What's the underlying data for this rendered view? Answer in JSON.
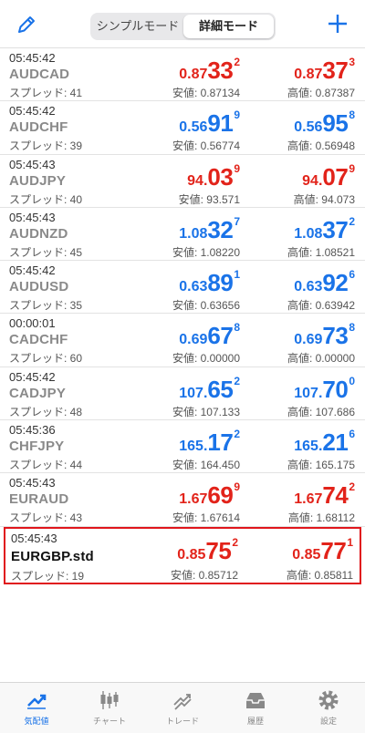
{
  "header": {
    "segment_simple": "シンプルモード",
    "segment_detail": "詳細モード"
  },
  "quotes": [
    {
      "time": "05:45:42",
      "symbol": "AUDCAD",
      "spread": "スプレッド: 41",
      "color": "red",
      "bid": {
        "small": "0.87",
        "big": "33",
        "sup": "2",
        "sub": "安値: 0.87134"
      },
      "ask": {
        "small": "0.87",
        "big": "37",
        "sup": "3",
        "sub": "高値: 0.87387"
      }
    },
    {
      "time": "05:45:42",
      "symbol": "AUDCHF",
      "spread": "スプレッド: 39",
      "color": "blue",
      "bid": {
        "small": "0.56",
        "big": "91",
        "sup": "9",
        "sub": "安値: 0.56774"
      },
      "ask": {
        "small": "0.56",
        "big": "95",
        "sup": "8",
        "sub": "高値: 0.56948"
      }
    },
    {
      "time": "05:45:43",
      "symbol": "AUDJPY",
      "spread": "スプレッド: 40",
      "color": "red",
      "bid": {
        "small": "94.",
        "big": "03",
        "sup": "9",
        "sub": "安値: 93.571"
      },
      "ask": {
        "small": "94.",
        "big": "07",
        "sup": "9",
        "sub": "高値: 94.073"
      }
    },
    {
      "time": "05:45:43",
      "symbol": "AUDNZD",
      "spread": "スプレッド: 45",
      "color": "blue",
      "bid": {
        "small": "1.08",
        "big": "32",
        "sup": "7",
        "sub": "安値: 1.08220"
      },
      "ask": {
        "small": "1.08",
        "big": "37",
        "sup": "2",
        "sub": "高値: 1.08521"
      }
    },
    {
      "time": "05:45:42",
      "symbol": "AUDUSD",
      "spread": "スプレッド: 35",
      "color": "blue",
      "bid": {
        "small": "0.63",
        "big": "89",
        "sup": "1",
        "sub": "安値: 0.63656"
      },
      "ask": {
        "small": "0.63",
        "big": "92",
        "sup": "6",
        "sub": "高値: 0.63942"
      }
    },
    {
      "time": "00:00:01",
      "symbol": "CADCHF",
      "spread": "スプレッド: 60",
      "color": "blue",
      "bid": {
        "small": "0.69",
        "big": "67",
        "sup": "8",
        "sub": "安値: 0.00000"
      },
      "ask": {
        "small": "0.69",
        "big": "73",
        "sup": "8",
        "sub": "高値: 0.00000"
      }
    },
    {
      "time": "05:45:42",
      "symbol": "CADJPY",
      "spread": "スプレッド: 48",
      "color": "blue",
      "bid": {
        "small": "107.",
        "big": "65",
        "sup": "2",
        "sub": "安値: 107.133"
      },
      "ask": {
        "small": "107.",
        "big": "70",
        "sup": "0",
        "sub": "高値: 107.686"
      }
    },
    {
      "time": "05:45:36",
      "symbol": "CHFJPY",
      "spread": "スプレッド: 44",
      "color": "blue",
      "bid": {
        "small": "165.",
        "big": "17",
        "sup": "2",
        "sub": "安値: 164.450"
      },
      "ask": {
        "small": "165.",
        "big": "21",
        "sup": "6",
        "sub": "高値: 165.175"
      }
    },
    {
      "time": "05:45:43",
      "symbol": "EURAUD",
      "spread": "スプレッド: 43",
      "color": "red",
      "bid": {
        "small": "1.67",
        "big": "69",
        "sup": "9",
        "sub": "安値: 1.67614"
      },
      "ask": {
        "small": "1.67",
        "big": "74",
        "sup": "2",
        "sub": "高値: 1.68112"
      }
    },
    {
      "time": "05:45:43",
      "symbol": "EURGBP.std",
      "spread": "スプレッド: 19",
      "color": "red",
      "bid": {
        "small": "0.85",
        "big": "75",
        "sup": "2",
        "sub": "安値: 0.85712"
      },
      "ask": {
        "small": "0.85",
        "big": "77",
        "sup": "1",
        "sub": "高値: 0.85811"
      }
    }
  ],
  "tabs": [
    {
      "label": "気配値",
      "icon": "quotes-icon",
      "active": true
    },
    {
      "label": "チャート",
      "icon": "chart-icon",
      "active": false
    },
    {
      "label": "トレード",
      "icon": "trade-icon",
      "active": false
    },
    {
      "label": "履歴",
      "icon": "history-icon",
      "active": false
    },
    {
      "label": "設定",
      "icon": "settings-icon",
      "active": false
    }
  ],
  "colors": {
    "accent": "#1a73e8",
    "down": "#e2231a",
    "selected_border": "#e0161c"
  }
}
